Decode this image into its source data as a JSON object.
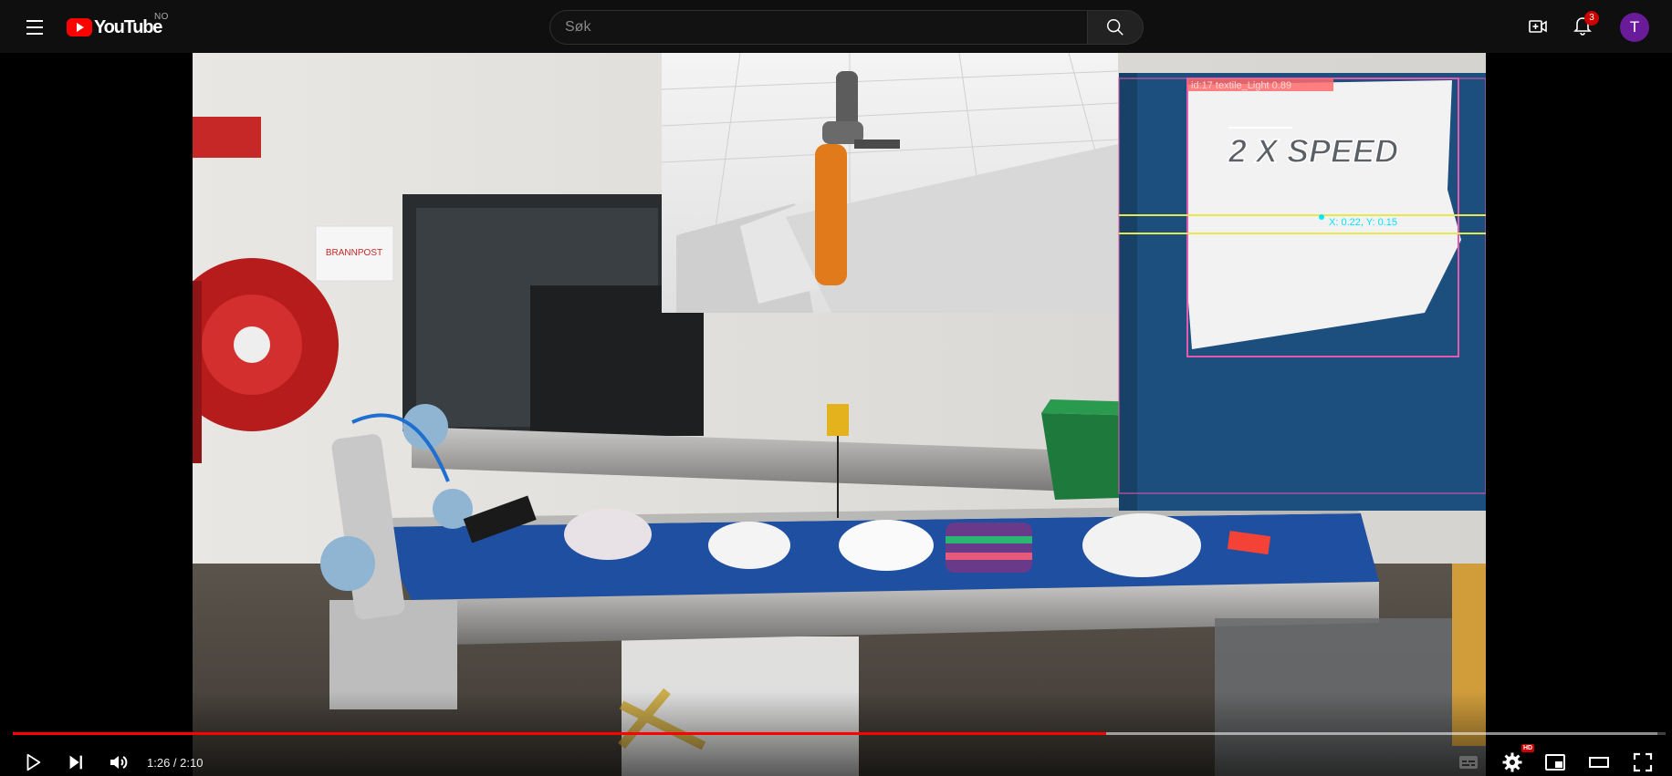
{
  "header": {
    "logo_text": "YouTube",
    "country_code": "NO",
    "search": {
      "placeholder": "Søk",
      "value": ""
    },
    "notifications_count": "3",
    "avatar_letter": "T"
  },
  "video": {
    "overlay_label": "2 X SPEED",
    "detection_label": "id:17 textile_Light 0.89",
    "coords_label": "X: 0.22, Y: 0.15",
    "sign_label": "BRANNPOST"
  },
  "player": {
    "current_time": "1:26",
    "duration": "2:10",
    "time_display": "1:26 / 2:10",
    "progress_fraction": 0.6615,
    "loaded_fraction": 0.995,
    "quality_badge": "HD"
  },
  "colors": {
    "brand_red": "#ff0000",
    "topbar_bg": "#0f0f0f",
    "avatar_bg": "#6a1b9a",
    "badge_red": "#cc0000"
  }
}
